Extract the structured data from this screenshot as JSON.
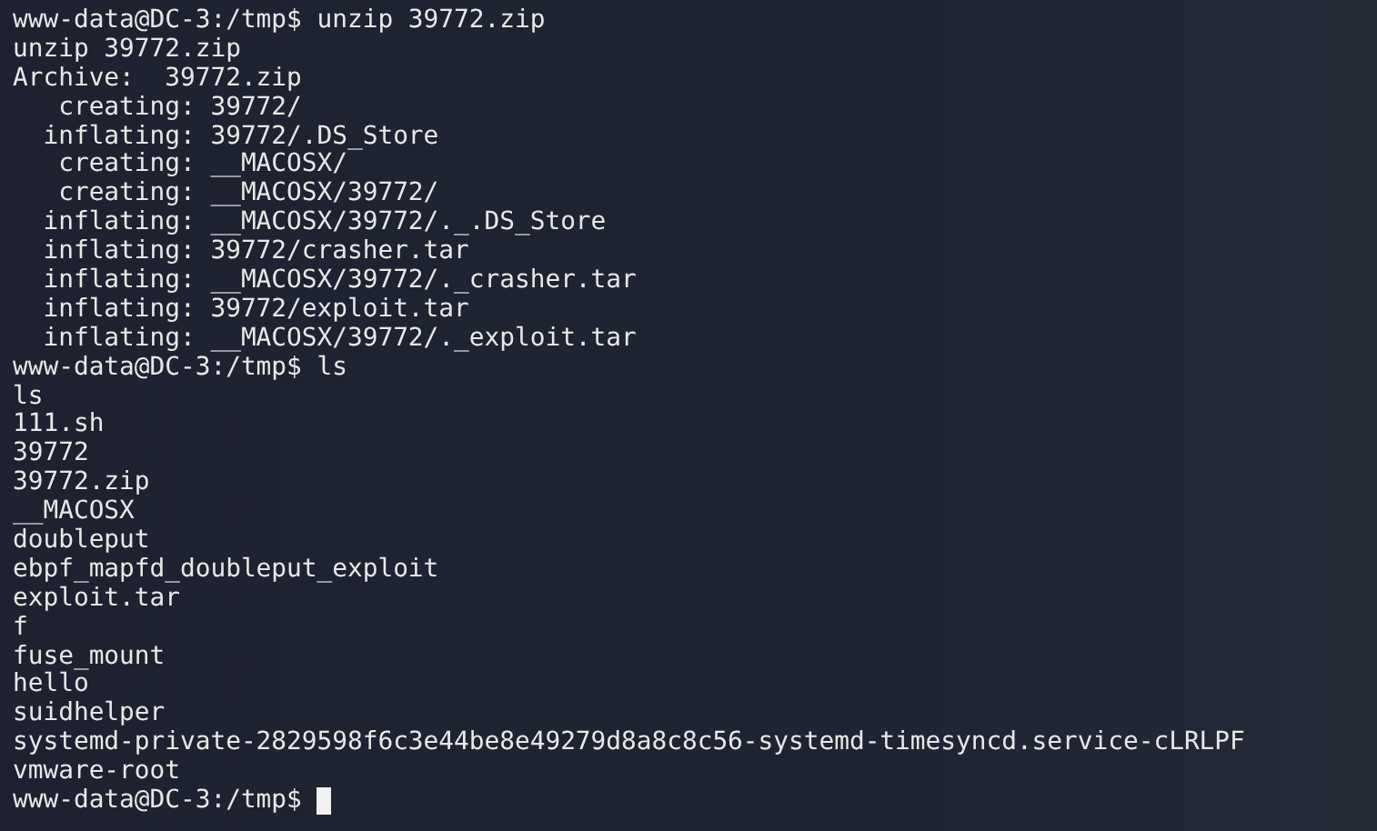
{
  "terminal": {
    "lines": [
      {
        "kind": "prompt",
        "prompt": "www-data@DC-3:/tmp$",
        "command": "unzip 39772.zip"
      },
      {
        "kind": "output",
        "text": "unzip 39772.zip"
      },
      {
        "kind": "output",
        "text": "Archive:  39772.zip"
      },
      {
        "kind": "output",
        "text": "   creating: 39772/"
      },
      {
        "kind": "output",
        "text": "  inflating: 39772/.DS_Store"
      },
      {
        "kind": "output",
        "text": "   creating: __MACOSX/"
      },
      {
        "kind": "output",
        "text": "   creating: __MACOSX/39772/"
      },
      {
        "kind": "output",
        "text": "  inflating: __MACOSX/39772/._.DS_Store"
      },
      {
        "kind": "output",
        "text": "  inflating: 39772/crasher.tar"
      },
      {
        "kind": "output",
        "text": "  inflating: __MACOSX/39772/._crasher.tar"
      },
      {
        "kind": "output",
        "text": "  inflating: 39772/exploit.tar"
      },
      {
        "kind": "output",
        "text": "  inflating: __MACOSX/39772/._exploit.tar"
      },
      {
        "kind": "prompt",
        "prompt": "www-data@DC-3:/tmp$",
        "command": "ls"
      },
      {
        "kind": "output",
        "text": "ls"
      },
      {
        "kind": "output",
        "text": "111.sh"
      },
      {
        "kind": "output",
        "text": "39772"
      },
      {
        "kind": "output",
        "text": "39772.zip"
      },
      {
        "kind": "output",
        "text": "__MACOSX"
      },
      {
        "kind": "output",
        "text": "doubleput"
      },
      {
        "kind": "output",
        "text": "ebpf_mapfd_doubleput_exploit"
      },
      {
        "kind": "output",
        "text": "exploit.tar"
      },
      {
        "kind": "output",
        "text": "f"
      },
      {
        "kind": "output",
        "text": "fuse_mount"
      },
      {
        "kind": "output",
        "text": "hello"
      },
      {
        "kind": "output",
        "text": "suidhelper"
      },
      {
        "kind": "output",
        "text": "systemd-private-2829598f6c3e44be8e49279d8a8c8c56-systemd-timesyncd.service-cLRLPF"
      },
      {
        "kind": "output",
        "text": "vmware-root"
      },
      {
        "kind": "input",
        "prompt": "www-data@DC-3:/tmp$",
        "cursor": true
      }
    ]
  }
}
